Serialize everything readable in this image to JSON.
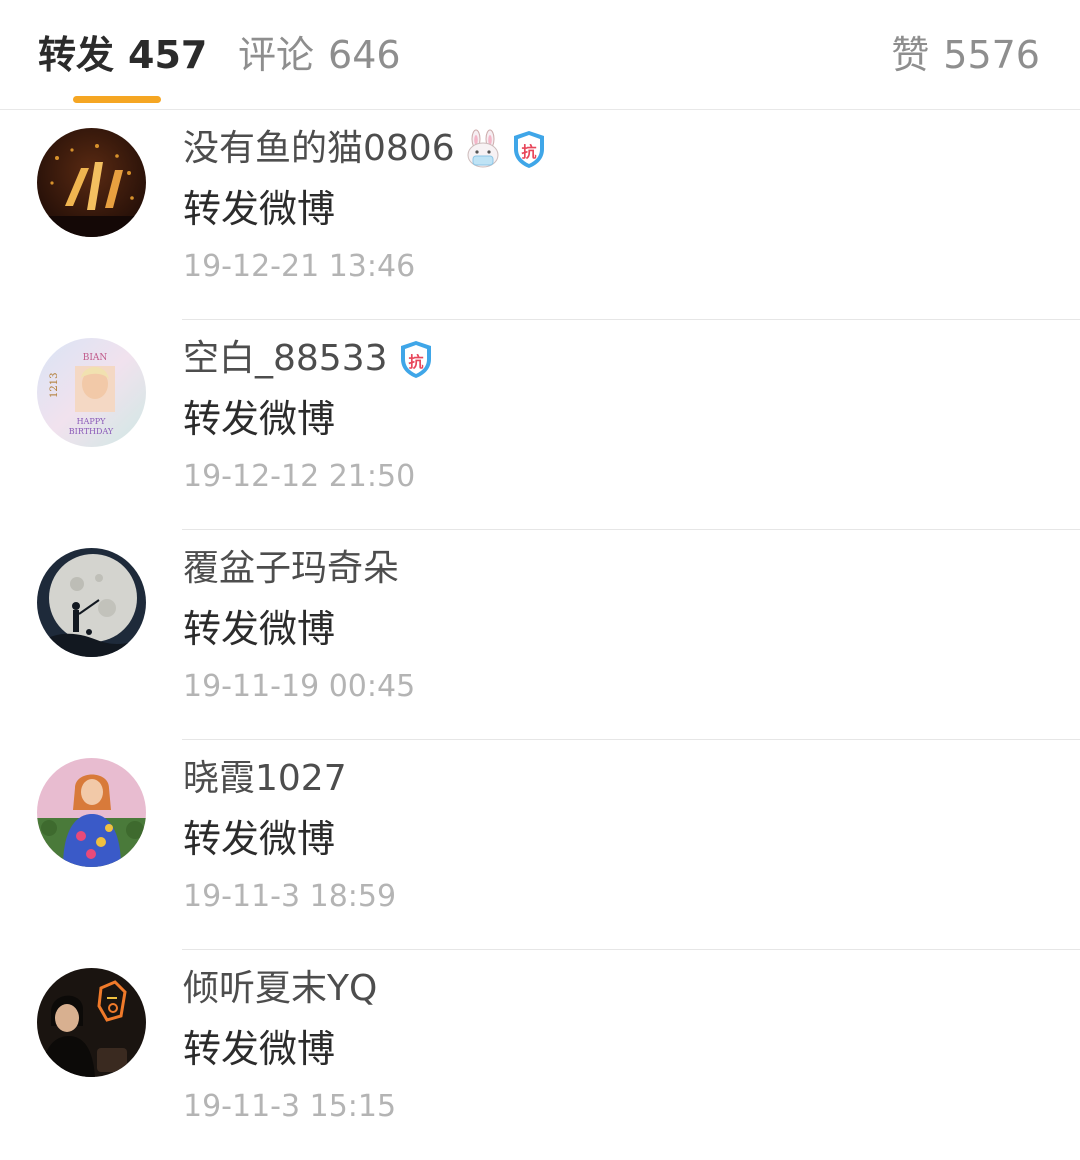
{
  "tabs": {
    "repost": {
      "label": "转发",
      "count": "457"
    },
    "comment": {
      "label": "评论",
      "count": "646"
    },
    "like": {
      "label": "赞",
      "count": "5576"
    },
    "accent_color": "#f5a623"
  },
  "reposts": [
    {
      "username": "没有鱼的猫0806",
      "content": "转发微博",
      "time": "19-12-21 13:46",
      "badges": [
        "bunny-mask-icon",
        "shield-kang-icon"
      ]
    },
    {
      "username": "空白_88533",
      "content": "转发微博",
      "time": "19-12-12 21:50",
      "badges": [
        "shield-kang-icon"
      ]
    },
    {
      "username": "覆盆子玛奇朵",
      "content": "转发微博",
      "time": "19-11-19 00:45",
      "badges": []
    },
    {
      "username": "晓霞1027",
      "content": "转发微博",
      "time": "19-11-3 18:59",
      "badges": []
    },
    {
      "username": "倾听夏末YQ",
      "content": "转发微博",
      "time": "19-11-3 15:15",
      "badges": []
    }
  ]
}
